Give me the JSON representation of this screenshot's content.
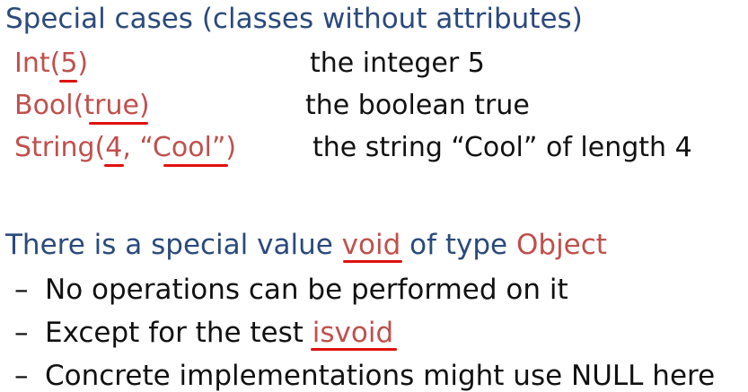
{
  "title": "Special cases (classes without attributes)",
  "examples": [
    {
      "code_prefix": "Int(",
      "code_arg": "5",
      "code_suffix": ")",
      "description": "the integer 5"
    },
    {
      "code_prefix": "Bool(",
      "code_arg": "true",
      "code_suffix": ")",
      "description": "the boolean true"
    },
    {
      "code_prefix": "String(",
      "code_arg": "4",
      "code_sep": ", “",
      "code_arg2": "Cool",
      "code_suffix": "”)",
      "description": "the string “Cool” of length 4"
    }
  ],
  "void_statement": {
    "prefix": "There is a special value ",
    "keyword": "void",
    "middle": " of type ",
    "type": "Object"
  },
  "bullets": [
    {
      "dash": "–",
      "text": "No operations can be performed on it"
    },
    {
      "dash": "–",
      "text_prefix": "Except for the test ",
      "keyword": "isvoid"
    },
    {
      "dash": "–",
      "text": "Concrete implementations might use NULL here"
    }
  ],
  "colors": {
    "heading": "#2b4a7c",
    "code": "#c0504d",
    "text": "#111111",
    "annotation": "#e01010"
  }
}
